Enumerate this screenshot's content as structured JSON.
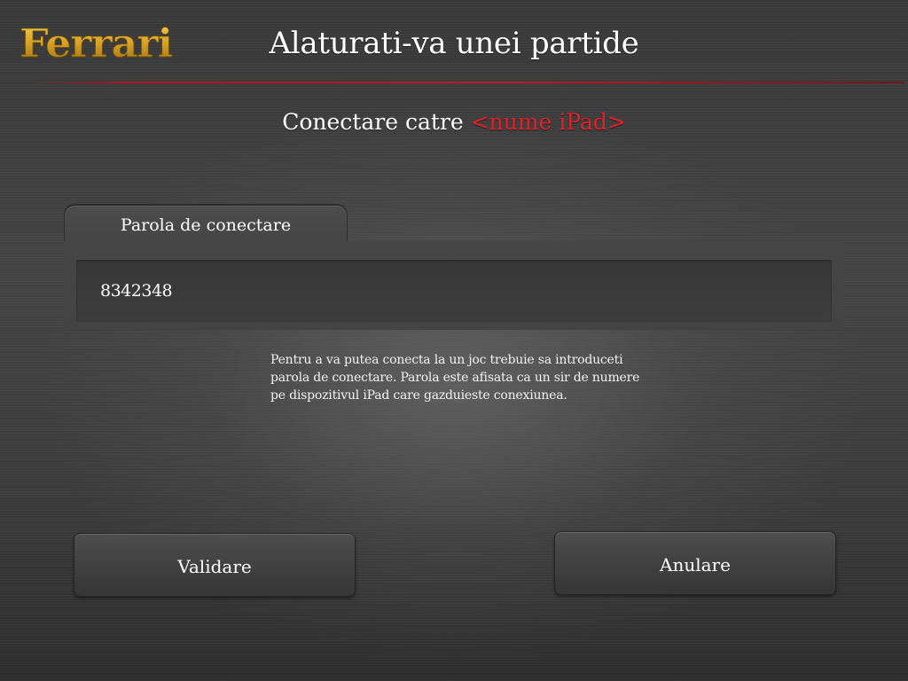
{
  "header": {
    "logo_text": "Ferrari",
    "title": "Alaturati-va unei partide"
  },
  "connection": {
    "prefix": "Conectare catre",
    "device_name": "<nume iPad>"
  },
  "password_panel": {
    "tab_label": "Parola de conectare",
    "value": "8342348"
  },
  "help_text": "Pentru a va putea conecta la un joc trebuie sa introduceti parola de conectare. Parola este afisata ca un sir de numere pe dispozitivul iPad care gazduieste conexiunea.",
  "buttons": {
    "validate_label": "Validare",
    "cancel_label": "Anulare"
  },
  "colors": {
    "accent_red": "#e0222a",
    "logo_gold": "#d9a425"
  }
}
